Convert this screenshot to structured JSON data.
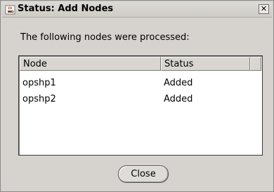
{
  "window": {
    "title": "Status: Add Nodes",
    "close_glyph": "✕",
    "app_icon": "java-coffee-cup-icon"
  },
  "message": "The following nodes were processed:",
  "table": {
    "columns": [
      "Node",
      "Status"
    ],
    "rows": [
      {
        "node": "opshp1",
        "status": "Added"
      },
      {
        "node": "opshp2",
        "status": "Added"
      }
    ]
  },
  "buttons": {
    "close_label": "Close"
  },
  "colors": {
    "background": "#d6d3ce",
    "table_background": "#ffffff",
    "header_background": "#d9d6d1"
  }
}
